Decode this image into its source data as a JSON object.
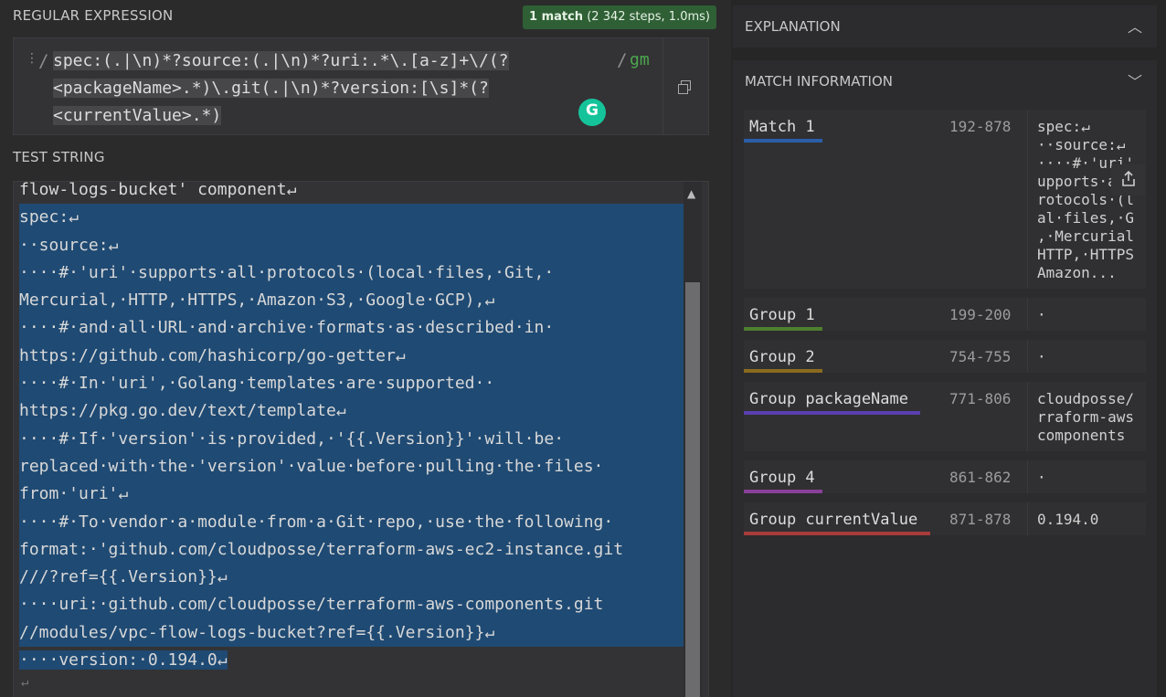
{
  "regex_section": {
    "title": "REGULAR EXPRESSION",
    "match_badge_count": "1 match",
    "match_badge_detail": "(2 342 steps, 1.0ms)",
    "open_delim": "/",
    "close_delim": "/",
    "flags": "gm",
    "lines": [
      "spec:(.|\\n)*?source:(.|\\n)*?uri:.*\\.[a-z]+\\/(?",
      "<packageName>.*)\\.git(.|\\n)*?version:[\\s]*(?",
      "<currentValue>.*)"
    ]
  },
  "test_section": {
    "title": "TEST STRING",
    "lines": [
      "flow-logs-bucket' component↵",
      "spec:↵",
      "··source:↵",
      "····#·'uri'·supports·all·protocols·(local·files,·Git,·",
      "Mercurial,·HTTP,·HTTPS,·Amazon·S3,·Google·GCP),↵",
      "····#·and·all·URL·and·archive·formats·as·described·in·",
      "https://github.com/hashicorp/go-getter↵",
      "····#·In·'uri',·Golang·templates·are·supported··",
      "https://pkg.go.dev/text/template↵",
      "····#·If·'version'·is·provided,·'{{.Version}}'·will·be·",
      "replaced·with·the·'version'·value·before·pulling·the·files·",
      "from·'uri'↵",
      "····#·To·vendor·a·module·from·a·Git·repo,·use·the·following·",
      "format:·'github.com/cloudposse/terraform-aws-ec2-instance.git",
      "///?ref={{.Version}}↵",
      "····uri:·github.com/cloudposse/terraform-aws-components.git",
      "//modules/vpc-flow-logs-bucket?ref={{.Version}}↵",
      "····version:·0.194.0↵"
    ],
    "trailing_newline": "↵"
  },
  "explanation": {
    "title": "EXPLANATION"
  },
  "match_information": {
    "title": "MATCH INFORMATION",
    "rows": [
      {
        "label": "Match 1",
        "range": "192-878",
        "value": "spec:↵\n··source:↵\n····#·'uri'\nupports·all\nrotocols·(l\nal·files,·G\n,·Mercurial\nHTTP,·HTTPS\nAmazon...",
        "color": "#2a5ea8"
      },
      {
        "label": "Group 1",
        "range": "199-200",
        "value": "·",
        "color": "#4e7f2e"
      },
      {
        "label": "Group 2",
        "range": "754-755",
        "value": "·",
        "color": "#8a6a1e"
      },
      {
        "label": "Group packageName",
        "range": "771-806",
        "value": "cloudposse/\nrraform-aws\ncomponents",
        "color": "#5a3fb0"
      },
      {
        "label": "Group 4",
        "range": "861-862",
        "value": "·",
        "color": "#8a3f9a"
      },
      {
        "label": "Group currentValue",
        "range": "871-878",
        "value": "0.194.0",
        "color": "#a83b3b"
      }
    ]
  },
  "colors": {
    "match_highlight": "#1f4a73",
    "badge": "#2f5f34",
    "flags": "#4ca84f"
  }
}
